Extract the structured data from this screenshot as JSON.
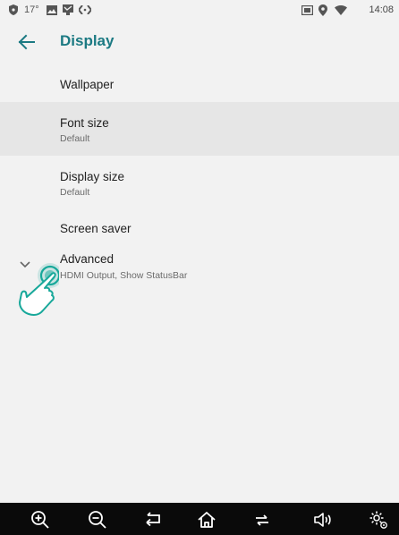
{
  "status_bar": {
    "temperature": "17°",
    "time": "14:08"
  },
  "header": {
    "title": "Display"
  },
  "settings": {
    "items": [
      {
        "title": "Wallpaper"
      },
      {
        "title": "Font size",
        "summary": "Default"
      },
      {
        "title": "Display size",
        "summary": "Default"
      },
      {
        "title": "Screen saver"
      },
      {
        "title": "Advanced",
        "summary": "HDMI Output, Show StatusBar"
      }
    ]
  },
  "colors": {
    "accent": "#1c7a83",
    "background": "#f2f2f2",
    "selected_row": "#e6e6e6",
    "nav_bar": "#0a0a0a",
    "hand_overlay": "#18a89a"
  },
  "icons": {
    "status": [
      "shield-icon",
      "image-icon",
      "screen-icon",
      "code-icon",
      "cast-icon",
      "location-icon",
      "wifi-icon"
    ],
    "nav": [
      "zoom-in-icon",
      "zoom-out-icon",
      "back-icon",
      "home-icon",
      "recents-icon",
      "volume-icon",
      "settings-icon"
    ]
  }
}
